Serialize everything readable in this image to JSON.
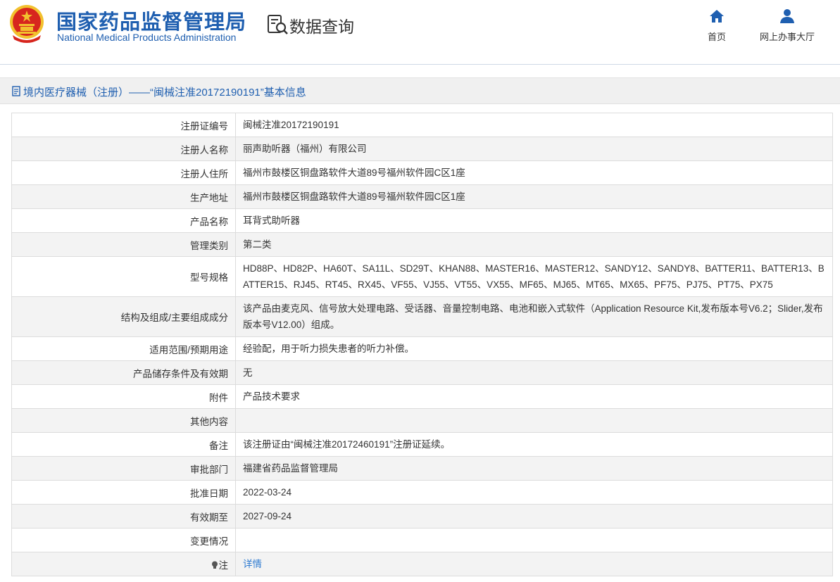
{
  "header": {
    "brand_cn": "国家药品监督管理局",
    "brand_en": "National Medical Products Administration",
    "query_title": "数据查询",
    "nav": {
      "home": "首页",
      "hall": "网上办事大厅"
    }
  },
  "breadcrumb": {
    "text": "境内医疗器械（注册）——“闽械注准20172190191”基本信息"
  },
  "table": {
    "rows": [
      {
        "label": "注册证编号",
        "value": "闽械注准20172190191"
      },
      {
        "label": "注册人名称",
        "value": "丽声助听器（福州）有限公司"
      },
      {
        "label": "注册人住所",
        "value": "福州市鼓楼区铜盘路软件大道89号福州软件园C区1座"
      },
      {
        "label": "生产地址",
        "value": "福州市鼓楼区铜盘路软件大道89号福州软件园C区1座"
      },
      {
        "label": "产品名称",
        "value": "耳背式助听器"
      },
      {
        "label": "管理类别",
        "value": "第二类"
      },
      {
        "label": "型号规格",
        "value": "HD88P、HD82P、HA60T、SA11L、SD29T、KHAN88、MASTER16、MASTER12、SANDY12、SANDY8、BATTER11、BATTER13、BATTER15、RJ45、RT45、RX45、VF55、VJ55、VT55、VX55、MF65、MJ65、MT65、MX65、PF75、PJ75、PT75、PX75"
      },
      {
        "label": "结构及组成/主要组成成分",
        "value": "该产品由麦克风、信号放大处理电路、受话器、音量控制电路、电池和嵌入式软件（Application Resource Kit,发布版本号V6.2；Slider,发布版本号V12.00）组成。"
      },
      {
        "label": "适用范围/预期用途",
        "value": "经验配，用于听力损失患者的听力补偿。"
      },
      {
        "label": "产品储存条件及有效期",
        "value": "无"
      },
      {
        "label": "附件",
        "value": "产品技术要求"
      },
      {
        "label": "其他内容",
        "value": ""
      },
      {
        "label": "备注",
        "value": "该注册证由“闽械注准20172460191”注册证延续。"
      },
      {
        "label": "审批部门",
        "value": "福建省药品监督管理局"
      },
      {
        "label": "批准日期",
        "value": "2022-03-24"
      },
      {
        "label": "有效期至",
        "value": "2027-09-24"
      },
      {
        "label": "变更情况",
        "value": ""
      },
      {
        "label": "注",
        "value": "详情"
      }
    ]
  },
  "colors": {
    "brand_blue": "#1f5fb0",
    "link_blue": "#2f7bd1",
    "emblem_red": "#d7261e",
    "emblem_gold": "#f2c12e"
  }
}
